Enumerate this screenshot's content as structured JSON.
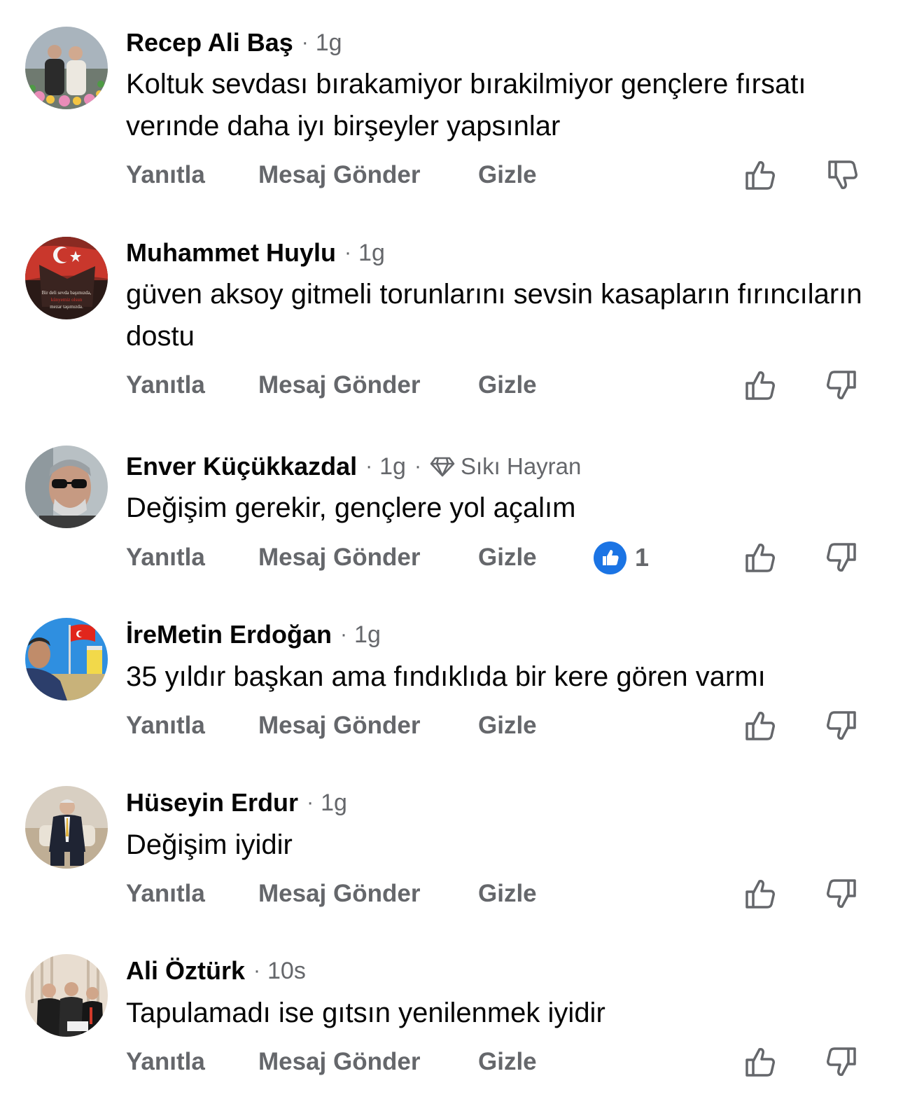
{
  "actions": {
    "reply": "Yanıtla",
    "message": "Mesaj Gönder",
    "hide": "Gizle"
  },
  "comments": [
    {
      "name": "Recep Ali Baş",
      "time": "1g",
      "text": "Koltuk sevdası bırakamiyor bırakilmiyor gençlere fırsatı verınde daha iyı birşeyler yapsınlar"
    },
    {
      "name": "Muhammet Huylu",
      "time": "1g",
      "text": "güven aksoy gitmeli torunlarını sevsin kasapların fırıncıların dostu",
      "avatar_text": [
        "Bir deli sevda başımızda,",
        "künyemiz olsun",
        "mezar taşımızda."
      ]
    },
    {
      "name": "Enver Küçükkazdal",
      "time": "1g",
      "badge": "Sıkı Hayran",
      "text": "Değişim gerekir, gençlere yol açalım",
      "reaction_count": "1"
    },
    {
      "name": "İreMetin Erdoğan",
      "time": "1g",
      "text": "35 yıldır başkan ama fındıklıda bir kere gören varmı"
    },
    {
      "name": "Hüseyin Erdur",
      "time": "1g",
      "text": "Değişim iyidir"
    },
    {
      "name": "Ali Öztürk",
      "time": "10s",
      "text": "Tapulamadı ise gıtsın yenilenmek iyidir"
    }
  ],
  "icons": {
    "like": "thumbs-up-icon",
    "dislike": "thumbs-down-icon",
    "reaction": "like-reaction-icon",
    "badge": "diamond-icon"
  },
  "colors": {
    "muted": "#65676b",
    "text": "#050505",
    "reaction_blue": "#1b74e4"
  }
}
